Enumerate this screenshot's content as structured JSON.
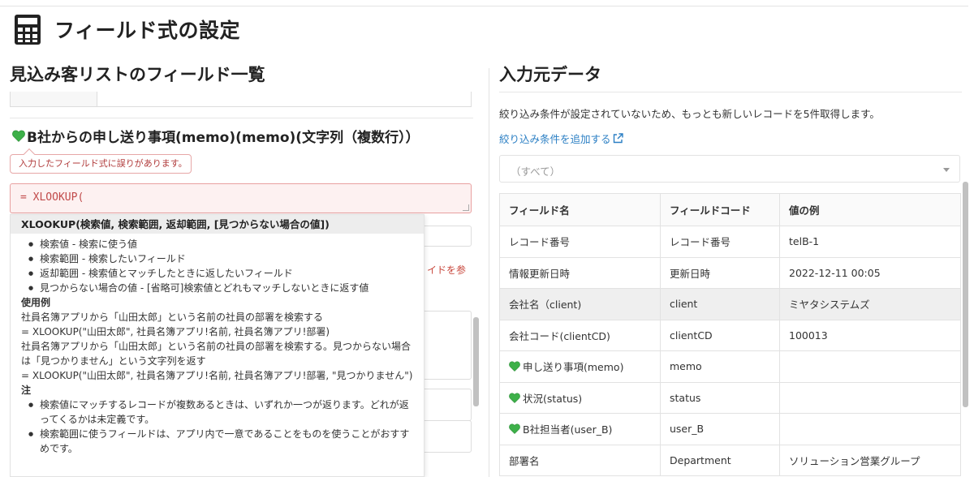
{
  "page": {
    "title": "フィールド式の設定"
  },
  "colors": {
    "accent_link": "#2b7fc4",
    "error": "#c14a4a",
    "heart": "#3db049"
  },
  "left": {
    "title": "見込み客リストのフィールド一覧",
    "field": {
      "heart_icon": "green-heart-icon",
      "label": "B社からの申し送り事項(memo)(memo)(文字列（複数行））",
      "error_message": "入力したフィールド式に誤りがあります。",
      "formula_value": "= XLOOKUP(",
      "guide_partial": "イドを参"
    },
    "autocomplete": {
      "signature": "XLOOKUP(検索値, 検索範囲, 返却範囲, [見つからない場合の値])",
      "params": [
        "検索値 - 検索に使う値",
        "検索範囲 - 検索したいフィールド",
        "返却範囲 - 検索値とマッチしたときに返したいフィールド",
        "見つからない場合の値 - [省略可]検索値とどれもマッチしないときに返す値"
      ],
      "example_heading": "使用例",
      "example1_desc": "社員名簿アプリから「山田太郎」という名前の社員の部署を検索する",
      "example1_code": "= XLOOKUP(\"山田太郎\", 社員名簿アプリ!名前, 社員名簿アプリ!部署)",
      "example2_desc": "社員名簿アプリから「山田太郎」という名前の社員の部署を検索する。見つからない場合は「見つかりません」という文字列を返す",
      "example2_code": "= XLOOKUP(\"山田太郎\", 社員名簿アプリ!名前, 社員名簿アプリ!部署, \"見つかりません\")",
      "notes_heading": "注",
      "notes": [
        "検索値にマッチするレコードが複数あるときは、いずれか一つが返ります。どれが返ってくるかは未定義です。",
        "検索範囲に使うフィールドは、アプリ内で一意であることをものを使うことがおすすめです。"
      ]
    }
  },
  "right": {
    "title": "入力元データ",
    "info": "絞り込み条件が設定されていないため、もっとも新しいレコードを5件取得します。",
    "add_filter_link": "絞り込み条件を追加する",
    "select_value": "（すべて）",
    "table": {
      "headers": [
        "フィールド名",
        "フィールドコード",
        "値の例"
      ],
      "rows": [
        {
          "name": "レコード番号",
          "code": "レコード番号",
          "value": "telB-1",
          "heart": false,
          "highlight": false
        },
        {
          "name": "情報更新日時",
          "code": "更新日時",
          "value": "2022-12-11 00:05",
          "heart": false,
          "highlight": false
        },
        {
          "name": "会社名（client)",
          "code": "client",
          "value": "ミヤタシステムズ",
          "heart": false,
          "highlight": true
        },
        {
          "name": "会社コード(clientCD)",
          "code": "clientCD",
          "value": "100013",
          "heart": false,
          "highlight": false
        },
        {
          "name": "申し送り事項(memo)",
          "code": "memo",
          "value": "",
          "heart": true,
          "highlight": false
        },
        {
          "name": "状況(status)",
          "code": "status",
          "value": "",
          "heart": true,
          "highlight": false
        },
        {
          "name": "B社担当者(user_B)",
          "code": "user_B",
          "value": "",
          "heart": true,
          "highlight": false
        },
        {
          "name": "部署名",
          "code": "Department",
          "value": "ソリューション営業グループ",
          "heart": false,
          "highlight": false
        }
      ]
    }
  }
}
